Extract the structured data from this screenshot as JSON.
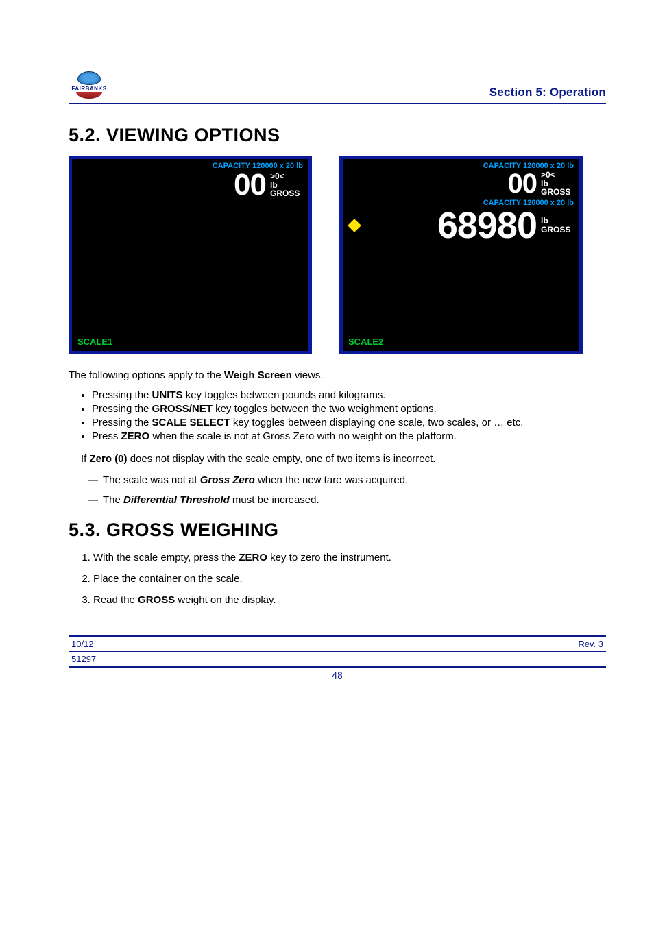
{
  "header": {
    "brand_upper": "FAIRBANKS",
    "section_label": "Section 5: Operation"
  },
  "section52": {
    "heading": "5.2.   VIEWING OPTIONS",
    "intro_prefix": "The following options apply to the ",
    "intro_bold": "Weigh Screen",
    "intro_suffix": " views.",
    "bullets": [
      {
        "pre": "Pressing the ",
        "key": "UNITS",
        "post": "key toggles between pounds and kilograms."
      },
      {
        "pre": "Pressing the ",
        "key": "GROSS/NET",
        "post": "key toggles between the two weighment options."
      },
      {
        "pre": "Pressing the ",
        "key": "SCALE SELECT",
        "post": "key toggles between displaying one scale, two scales, or … etc."
      },
      {
        "pre": "Press ",
        "key": "ZERO",
        "post": " when the scale is not at Gross Zero with no weight on the platform."
      }
    ],
    "dash_lead": {
      "pre": "If ",
      "bold": "Zero (0)",
      "post": " does not display with the scale empty, one of two items is incorrect."
    },
    "dashes": [
      {
        "pre": "The scale was not at ",
        "bi": "Gross Zero",
        "post": " when the new tare was acquired."
      },
      {
        "pre": "The ",
        "bi": "Differential Threshold",
        "post": " must be increased."
      }
    ]
  },
  "screens": {
    "left": {
      "capacity": "CAPACITY 120000 x 20 lb",
      "weight": "00",
      "zero": ">0<",
      "unit": "lb",
      "mode": "GROSS",
      "label": "SCALE1"
    },
    "right": {
      "cap1": "CAPACITY 120000 x 20 lb",
      "w1": "00",
      "zero1": ">0<",
      "unit1": "lb",
      "mode1": "GROSS",
      "cap2": "CAPACITY 120000 x 20 lb",
      "w2": "68980",
      "unit2": "lb",
      "mode2": "GROSS",
      "label": "SCALE2"
    }
  },
  "section53": {
    "heading": "5.3.  GROSS WEIGHING",
    "steps": [
      {
        "pre": "With the scale empty, press the ",
        "bold": "ZERO",
        "post": " key to zero the instrument."
      },
      {
        "text": "Place the container on the scale."
      },
      {
        "pre": "Read the ",
        "bold": "GROSS",
        "post": " weight on the display."
      }
    ]
  },
  "footer": {
    "left1": "10/12",
    "left2": "51297",
    "center": "48",
    "right": "Rev. 3"
  }
}
